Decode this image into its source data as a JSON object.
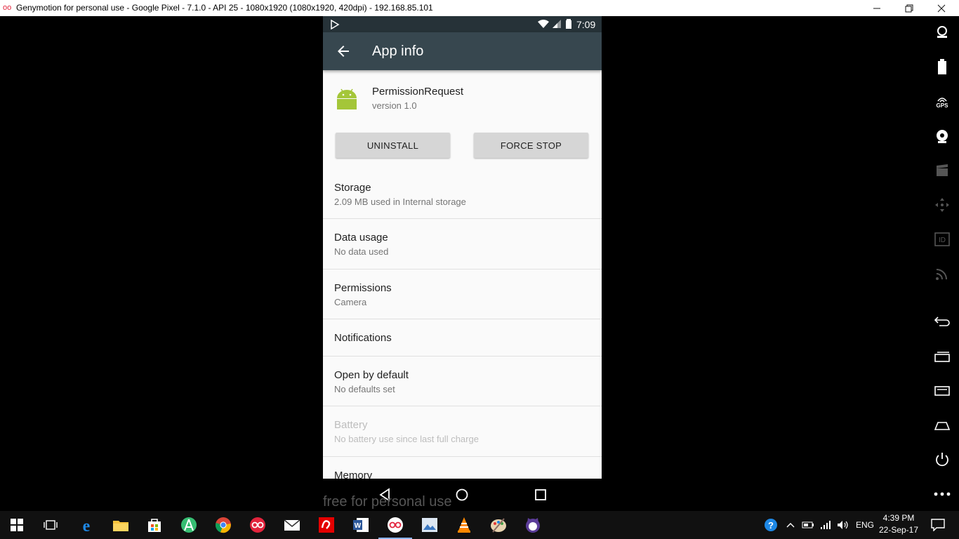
{
  "window": {
    "title": "Genymotion for personal use - Google Pixel - 7.1.0 - API 25 - 1080x1920 (1080x1920, 420dpi) - 192.168.85.101",
    "controls": {
      "minimize": "—",
      "restore": "❐",
      "close": "✕"
    }
  },
  "status_bar": {
    "time": "7:09"
  },
  "app_bar": {
    "title": "App info"
  },
  "app": {
    "name": "PermissionRequest",
    "version": "version 1.0"
  },
  "buttons": {
    "uninstall": "UNINSTALL",
    "force_stop": "FORCE STOP"
  },
  "settings": [
    {
      "title": "Storage",
      "subtitle": "2.09 MB used in Internal storage"
    },
    {
      "title": "Data usage",
      "subtitle": "No data used"
    },
    {
      "title": "Permissions",
      "subtitle": "Camera"
    },
    {
      "title": "Notifications",
      "subtitle": ""
    },
    {
      "title": "Open by default",
      "subtitle": "No defaults set"
    },
    {
      "title": "Battery",
      "subtitle": "No battery use since last full charge",
      "disabled": true
    },
    {
      "title": "Memory",
      "subtitle": ""
    }
  ],
  "emulator_sidebar": {
    "gps_label": "GPS",
    "id_label": "ID"
  },
  "watermark": "free for personal use",
  "taskbar": {
    "language": "ENG",
    "time": "4:39 PM",
    "date": "22-Sep-17"
  },
  "colors": {
    "status_bar": "#263238",
    "app_bar": "#37474f",
    "android_green": "#a4c639",
    "button_bg": "#d6d6d6"
  }
}
